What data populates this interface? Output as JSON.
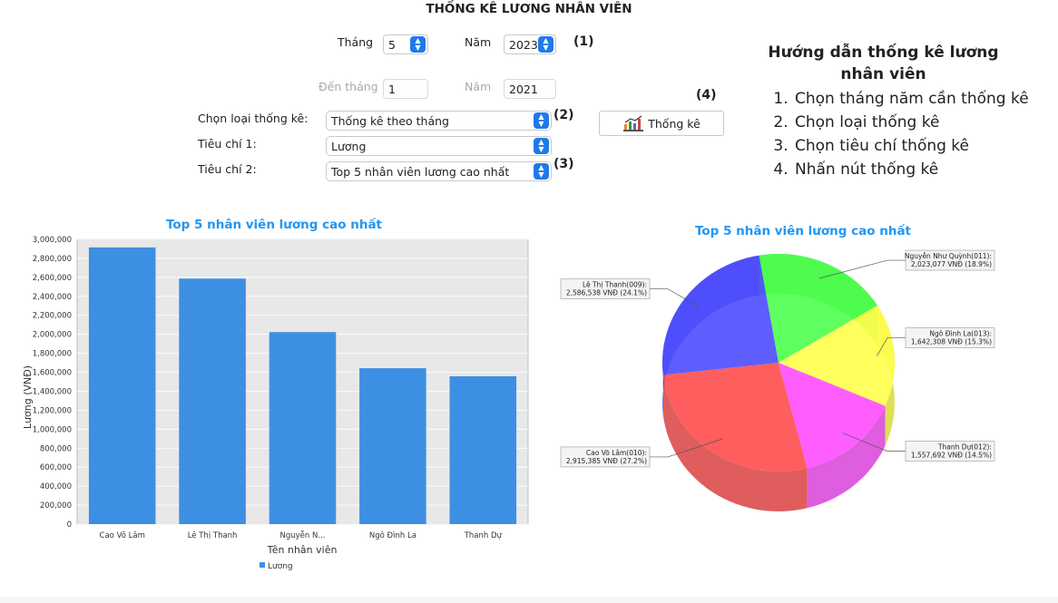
{
  "window": {
    "title": "THỐNG KÊ LƯƠNG NHÂN VIÊN"
  },
  "filters": {
    "month_label": "Tháng",
    "month_value": "5",
    "year_label": "Năm",
    "year_value": "2023",
    "to_month_label": "Đến tháng",
    "to_month_value": "1",
    "to_year_label": "Năm",
    "to_year_value": "2021",
    "stat_type_label": "Chọn loại thống kê:",
    "stat_type_value": "Thống kê theo tháng",
    "criteria1_label": "Tiêu chí 1:",
    "criteria1_value": "Lương",
    "criteria2_label": "Tiêu chí 2:",
    "criteria2_value": "Top 5 nhân viên lương cao nhất"
  },
  "annotations": {
    "a1": "(1)",
    "a2": "(2)",
    "a3": "(3)",
    "a4": "(4)"
  },
  "stat_button": {
    "label": "Thống kê",
    "icon": "bar-chart-icon"
  },
  "guide": {
    "title": "Hướng dẫn thống kê lương nhân viên",
    "steps": [
      "Chọn tháng năm cần thống kê",
      "Chọn loại thống kê",
      "Chọn tiêu chí thống kê",
      "Nhấn nút thống kê"
    ]
  },
  "colors": {
    "accent": "#1f7ae9",
    "bar": "#3d8fe3",
    "chart_title": "#2196f3"
  },
  "chart_data": [
    {
      "type": "bar",
      "title": "Top 5 nhân viên lương cao nhất",
      "xlabel": "Tên nhân viên",
      "ylabel": "Lương (VNĐ)",
      "categories": [
        "Cao Võ Lâm",
        "Lê Thị Thanh",
        "Nguyễn N...",
        "Ngô Đình La",
        "Thanh Dự"
      ],
      "series": [
        {
          "name": "Lương",
          "values": [
            2915385,
            2586538,
            2023077,
            1642308,
            1557692
          ]
        }
      ],
      "ylim": [
        0,
        3000000
      ],
      "yticks": [
        "0",
        "200,000",
        "400,000",
        "600,000",
        "800,000",
        "1,000,000",
        "1,200,000",
        "1,400,000",
        "1,600,000",
        "1,800,000",
        "2,000,000",
        "2,200,000",
        "2,400,000",
        "2,600,000",
        "2,800,000",
        "3,000,000"
      ],
      "grid": true,
      "legend": "bottom"
    },
    {
      "type": "pie",
      "title": "Top 5 nhân viên lương cao nhất",
      "slices": [
        {
          "label": "Cao Võ Lâm(010): 2,915,385  VNĐ (27.2%)",
          "value": 2915385,
          "color": "#ff4d4d"
        },
        {
          "label": "Lê Thị Thanh(009): 2,586,538  VNĐ (24.1%)",
          "value": 2586538,
          "color": "#4d4dff"
        },
        {
          "label": "Nguyễn Như Quỳnh(011): 2,023,077  VNĐ (18.9%)",
          "value": 2023077,
          "color": "#4dff4d"
        },
        {
          "label": "Ngô Đình La(013): 1,642,308  VNĐ (15.3%)",
          "value": 1642308,
          "color": "#ffff4d"
        },
        {
          "label": "Thanh Dự(012): 1,557,692  VNĐ (14.5%)",
          "value": 1557692,
          "color": "#ff4dff"
        }
      ]
    }
  ]
}
